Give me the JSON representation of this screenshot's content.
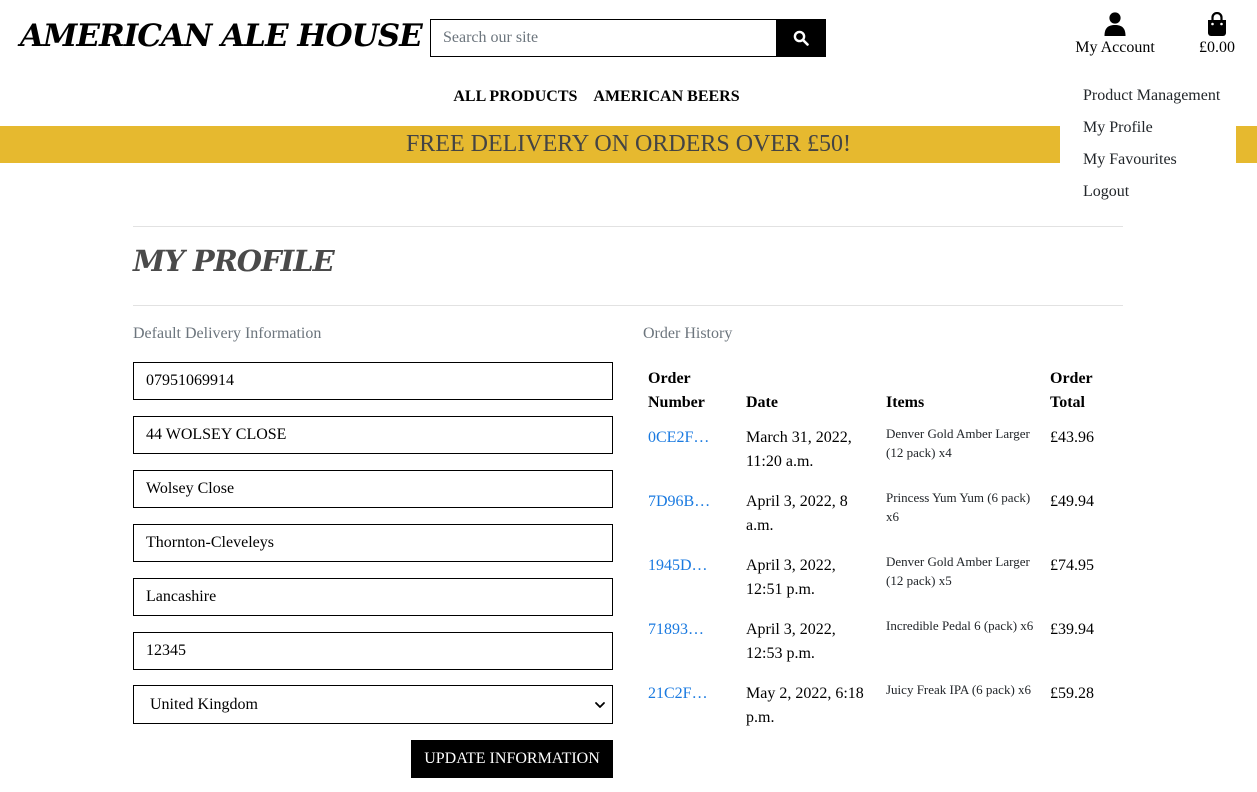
{
  "header": {
    "logo": "AMERICAN ALE HOUSE",
    "search_placeholder": "Search our site",
    "account_label": "My Account",
    "bag_total": "£0.00"
  },
  "nav": {
    "items": [
      "ALL PRODUCTS",
      "AMERICAN BEERS"
    ]
  },
  "banner": "FREE DELIVERY ON ORDERS OVER £50!",
  "account_menu": [
    "Product Management",
    "My Profile",
    "My Favourites",
    "Logout"
  ],
  "page": {
    "title": "MY PROFILE"
  },
  "delivery": {
    "label": "Default Delivery Information",
    "phone": "07951069914",
    "street1": "44 WOLSEY CLOSE",
    "street2": "Wolsey Close",
    "town": "Thornton-Cleveleys",
    "county": "Lancashire",
    "postcode": "12345",
    "country": "United Kingdom",
    "submit_label": "UPDATE INFORMATION"
  },
  "orders": {
    "label": "Order History",
    "headers": [
      "Order Number",
      "Date",
      "Items",
      "Order Total"
    ],
    "rows": [
      {
        "number": "0CE2F…",
        "date": "March 31, 2022, 11:20 a.m.",
        "items": "Denver Gold Amber Larger (12 pack) x4",
        "total": "£43.96"
      },
      {
        "number": "7D96B…",
        "date": "April 3, 2022, 8 a.m.",
        "items": "Princess Yum Yum (6 pack) x6",
        "total": "£49.94"
      },
      {
        "number": "1945D…",
        "date": "April 3, 2022, 12:51 p.m.",
        "items": "Denver Gold Amber Larger (12 pack) x5",
        "total": "£74.95"
      },
      {
        "number": "71893…",
        "date": "April 3, 2022, 12:53 p.m.",
        "items": "Incredible Pedal 6 (pack) x6",
        "total": "£39.94"
      },
      {
        "number": "21C2F…",
        "date": "May 2, 2022, 6:18 p.m.",
        "items": "Juicy Freak IPA (6 pack) x6",
        "total": "£59.28"
      }
    ]
  }
}
